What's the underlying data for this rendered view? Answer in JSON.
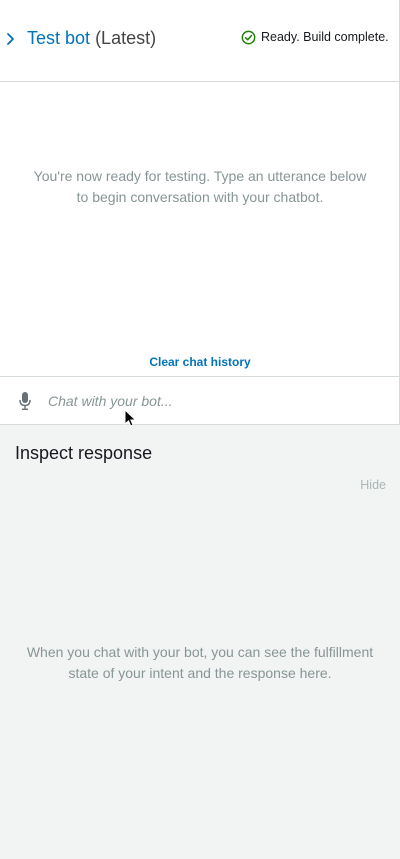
{
  "header": {
    "bot_name": "Test bot",
    "version_label": "(Latest)",
    "status_text": "Ready. Build complete.",
    "status_color": "#1d8102",
    "link_color": "#0073bb"
  },
  "chat": {
    "empty_message": "You're now ready for testing. Type an utterance below to begin conversation with your chatbot.",
    "clear_label": "Clear chat history",
    "input_placeholder": "Chat with your bot...",
    "input_value": ""
  },
  "inspect": {
    "title": "Inspect response",
    "hide_label": "Hide",
    "empty_message": "When you chat with your bot, you can see the fulfillment state of your intent and the response here."
  },
  "icons": {
    "expand": "chevron-right-icon",
    "status": "check-circle-icon",
    "microphone": "microphone-icon",
    "pointer": "mouse-pointer-icon"
  }
}
